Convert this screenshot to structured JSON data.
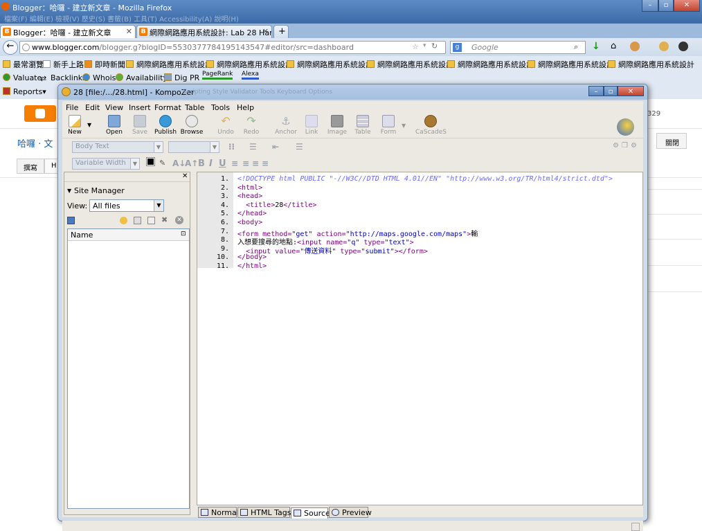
{
  "firefox": {
    "window_title": "Blogger：哈囉 - 建立新文章 - Mozilla Firefox",
    "menu_ghost": "檔案(F)  編輯(E)  檢視(V)  歷史(S)  書籤(B)  工具(T)  Accessibility(A)  說明(H)",
    "tabs": [
      {
        "label": "Blogger：哈囉 - 建立新文章"
      },
      {
        "label": "網際網路應用系統設計: Lab 28 Hand..."
      }
    ],
    "new_tab": "+",
    "url_host": "www.blogger.com",
    "url_rest": "/blogger.g?blogID=5530377784195143547#editor/src=dashboard",
    "search_placeholder": "Google",
    "bookmarks": [
      "最常瀏覽",
      "新手上路",
      "即時新聞",
      "網際網路應用系統設計",
      "網際網路應用系統設計",
      "網際網路應用系統設計",
      "網際網路應用系統設計",
      "網際網路應用系統設計",
      "網際網路應用系統設計",
      "網際網路應用系統設計",
      "網際網路應用系統設計"
    ],
    "toolbar2": [
      "Valuate",
      "Backlinks",
      "Whois",
      "Availability",
      "Dig PR",
      "PageRank",
      "Alexa"
    ],
    "toolbar3": "Reports",
    "blog_bg": {
      "post_title": "哈囉 · 文",
      "tab_compose": "撰寫",
      "tab_html": "H",
      "close_btn": "關閉",
      "counter": "329"
    }
  },
  "kompozer": {
    "title": "28 [file:/.../28.html] - KompoZer",
    "title_ghost": "Scripting   Style   Validator   Tools   Keyboard   Options",
    "menus": [
      "File",
      "Edit",
      "View",
      "Insert",
      "Format",
      "Table",
      "Tools",
      "Help"
    ],
    "toolbar": [
      {
        "label": "New",
        "enabled": true
      },
      {
        "label": "Open",
        "enabled": true
      },
      {
        "label": "Save",
        "enabled": false
      },
      {
        "label": "Publish",
        "enabled": true
      },
      {
        "label": "Browse",
        "enabled": true
      },
      {
        "label": "Undo",
        "enabled": false
      },
      {
        "label": "Redo",
        "enabled": false
      },
      {
        "label": "Anchor",
        "enabled": false
      },
      {
        "label": "Link",
        "enabled": false
      },
      {
        "label": "Image",
        "enabled": false
      },
      {
        "label": "Table",
        "enabled": false
      },
      {
        "label": "Form",
        "enabled": false
      },
      {
        "label": "CaScadeS",
        "enabled": false
      }
    ],
    "paragraph_format": "Body Text",
    "font_width": "Variable Width",
    "format_buttons": [
      "B",
      "I",
      "U"
    ],
    "site_manager": {
      "title": "Site Manager",
      "view_label": "View:",
      "view_value": "All files",
      "column_name": "Name"
    },
    "source_lines": [
      {
        "n": "1.",
        "html": "<!DOCTYPE html PUBLIC \"-//W3C//DTD HTML 4.01//EN\" \"http://www.w3.org/TR/html4/strict.dtd\">"
      },
      {
        "n": "2.",
        "html": "<html>"
      },
      {
        "n": "3.",
        "html": "<head>"
      },
      {
        "n": "4.",
        "html": "  <title>28</title>"
      },
      {
        "n": "5.",
        "html": "</head>"
      },
      {
        "n": "6.",
        "html": "<body>"
      },
      {
        "n": "7.",
        "html": "<form method=\"get\" action=\"http://maps.google.com/maps\">輸"
      },
      {
        "n": "8.",
        "html": "入想要搜尋的地點:<input name=\"q\" type=\"text\">"
      },
      {
        "n": "9.",
        "html": "  <input value=\"傳送資料\" type=\"submit\"></form>"
      },
      {
        "n": "10.",
        "html": "</body>"
      },
      {
        "n": "11.",
        "html": "</html>"
      }
    ],
    "view_tabs": [
      {
        "label": "Normal",
        "active": false
      },
      {
        "label": "HTML Tags",
        "active": false
      },
      {
        "label": "Source",
        "active": true
      },
      {
        "label": "Preview",
        "active": false
      }
    ]
  },
  "colors": {
    "titlebar": "#3a6aa8",
    "tag": "#800080",
    "value": "#0000c0",
    "doctype": "#6a6aff"
  }
}
